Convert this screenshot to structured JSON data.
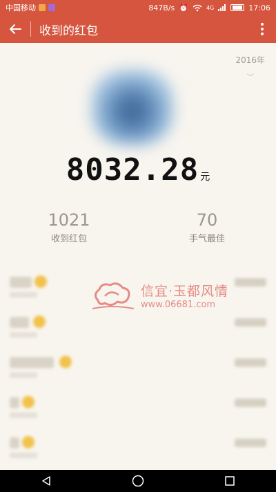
{
  "status_bar": {
    "carrier": "中国移动",
    "speed": "847B/s",
    "network": "4G",
    "time": "17:06"
  },
  "app_bar": {
    "back_icon": "arrow-left-icon",
    "title": "收到的红包",
    "more_icon": "more-vert-icon"
  },
  "header": {
    "year": "2016年",
    "year_icon": "chevron-down-icon",
    "amount": "8032.28",
    "unit": "元"
  },
  "stats": {
    "received_count": "1021",
    "received_label": "收到红包",
    "best_count": "70",
    "best_label": "手气最佳"
  },
  "watermark": {
    "title": "信宜·玉都风情",
    "url": "www.06681.com"
  },
  "colors": {
    "header": "#d5553e",
    "background": "#f8f5ef",
    "badge": "#f1c24c"
  }
}
